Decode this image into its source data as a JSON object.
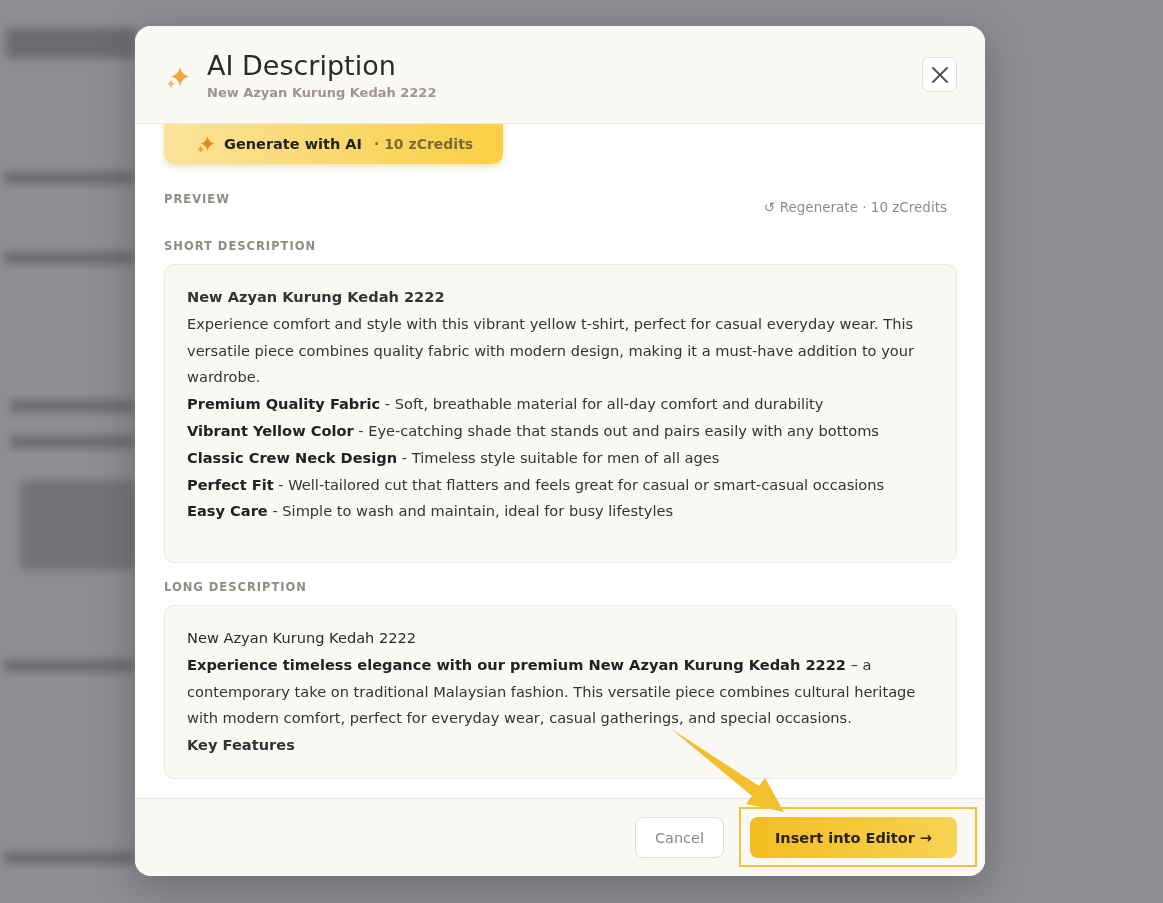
{
  "dialog": {
    "title": "AI Description",
    "subtitle": "New Azyan Kurung Kedah 2222"
  },
  "generate_button": {
    "label": "Generate with AI",
    "cost": "· 10 zCredits"
  },
  "preview": {
    "label": "PREVIEW",
    "regenerate": "↺ Regenerate · 10 zCredits"
  },
  "sections": [
    {
      "label": "SHORT DESCRIPTION",
      "lines": [
        {
          "kind": "heading",
          "text": "New Azyan Kurung Kedah 2222"
        },
        {
          "kind": "paragraph",
          "text": "Experience comfort and style with this vibrant yellow t-shirt, perfect for casual everyday wear. This versatile piece combines quality fabric with modern design, making it a must-have addition to your wardrobe."
        },
        {
          "kind": "paragraph",
          "text": "**Premium Quality Fabric** - Soft, breathable material for all-day comfort and durability"
        },
        {
          "kind": "paragraph",
          "text": "**Vibrant Yellow Color** - Eye-catching shade that stands out and pairs easily with any bottoms"
        },
        {
          "kind": "paragraph",
          "text": "**Classic Crew Neck Design** - Timeless style suitable for men of all ages"
        },
        {
          "kind": "paragraph",
          "text": "**Perfect Fit** - Well-tailored cut that flatters and feels great for casual or smart-casual occasions"
        },
        {
          "kind": "paragraph",
          "text": "**Easy Care** - Simple to wash and maintain, ideal for busy lifestyles"
        }
      ]
    },
    {
      "label": "LONG DESCRIPTION",
      "lines": [
        {
          "kind": "title",
          "text": "New Azyan Kurung Kedah 2222"
        },
        {
          "kind": "paragraph",
          "text": "**Experience timeless elegance with our premium New Azyan Kurung Kedah 2222** – a contemporary take on traditional Malaysian fashion. This versatile piece combines cultural heritage with modern comfort, perfect for everyday wear, casual gatherings, and special occasions."
        },
        {
          "kind": "heading",
          "text": "Key Features"
        }
      ]
    }
  ],
  "footer": {
    "buttons": [
      {
        "label": "Cancel",
        "kind": "secondary"
      },
      {
        "label": "Insert into Editor →",
        "kind": "primary"
      }
    ]
  }
}
